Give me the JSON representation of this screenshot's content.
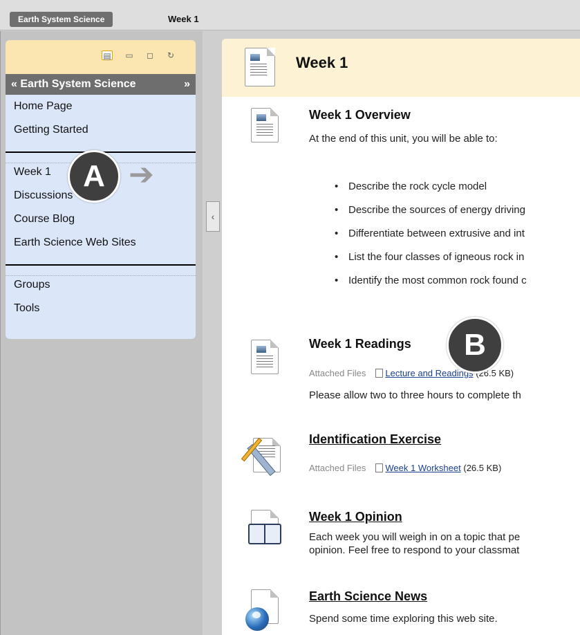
{
  "breadcrumb": {
    "course": "Earth System Science",
    "page": "Week 1"
  },
  "sidebar": {
    "title": "Earth System Science",
    "title_left_glyph": "«",
    "title_right_glyph": "»",
    "toolbar_icons": [
      "list-view-icon",
      "folder-view-icon",
      "window-icon",
      "refresh-icon"
    ],
    "group1": [
      "Home Page",
      "Getting Started"
    ],
    "group2": [
      "Week 1",
      "Discussions",
      "Course Blog",
      "Earth Science Web Sites"
    ],
    "group3": [
      "Groups",
      "Tools"
    ]
  },
  "callouts": {
    "a": "A",
    "b": "B"
  },
  "content": {
    "title": "Week 1",
    "overview": {
      "title": "Week 1 Overview",
      "intro": "At the end of this unit, you will be able to:",
      "objectives": [
        "Describe the rock cycle model",
        "Describe the sources of energy driving",
        "Differentiate between extrusive and int",
        "List the four classes of igneous rock in",
        "Identify the most common rock found c"
      ]
    },
    "readings": {
      "title": "Week 1 Readings",
      "attached_label": "Attached Files",
      "file_name": "Lecture and Readings",
      "file_size": "(26.5 KB)",
      "desc": "Please allow two to three hours to complete th"
    },
    "exercise": {
      "title": "Identification Exercise",
      "attached_label": "Attached Files",
      "file_name": "Week 1 Worksheet",
      "file_size": "(26.5 KB)"
    },
    "opinion": {
      "title": "Week 1 Opinion",
      "desc_line1": "Each week you will weigh in on a topic that pe",
      "desc_line2": "opinion. Feel free to respond to your classmat"
    },
    "news": {
      "title": "Earth Science News",
      "desc": "Spend some time exploring this web site."
    }
  }
}
